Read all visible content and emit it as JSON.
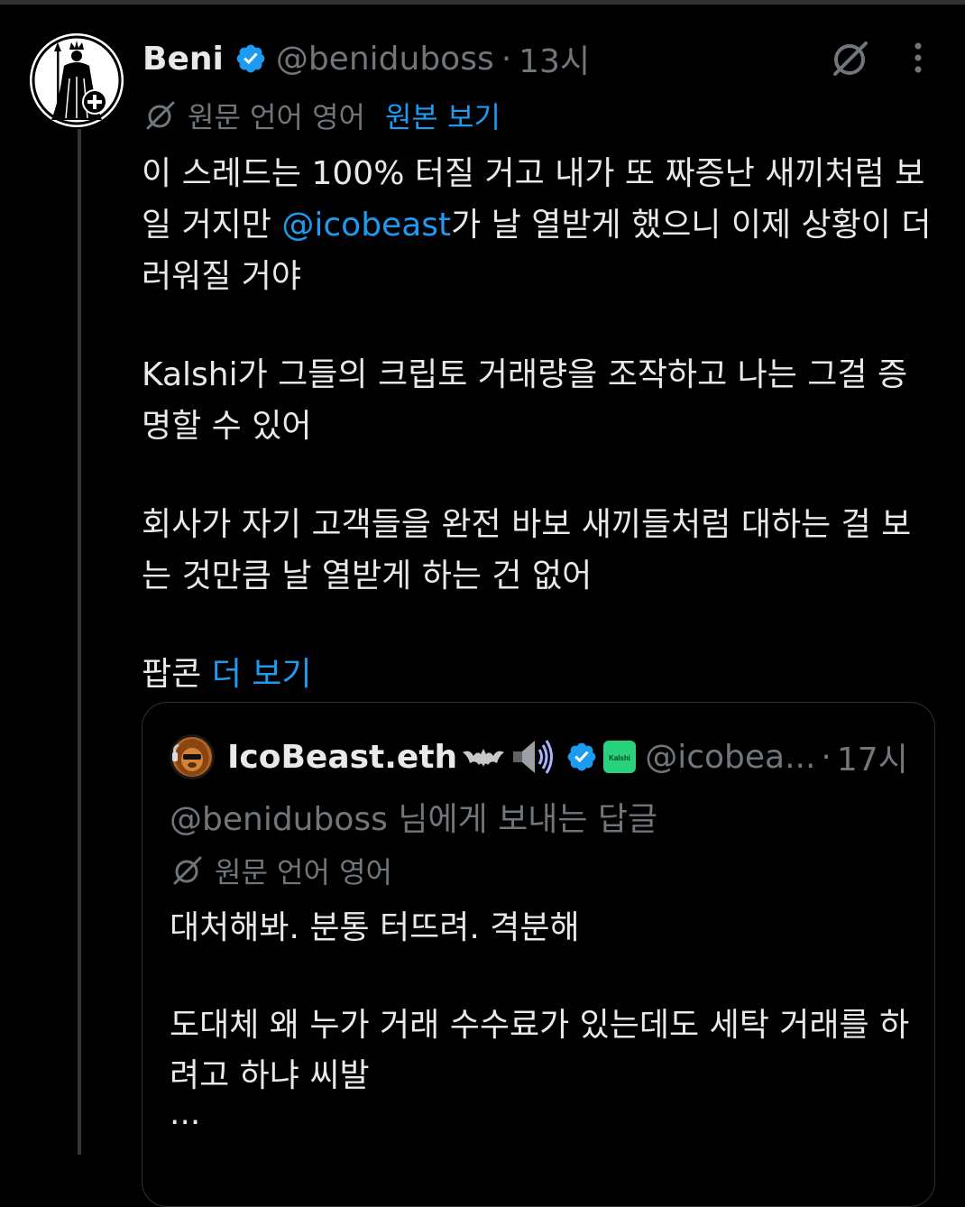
{
  "tweet": {
    "author_name": "Beni",
    "author_handle": "@beniduboss",
    "separator": "·",
    "time": "13시",
    "translation_label": "원문 언어 영어",
    "show_original_label": "원본 보기",
    "paragraph1_a": "이 스레드는 100% 터질 거고 내가 또 짜증난 새끼처럼 보일 거지만 ",
    "paragraph1_mention": "@icobeast",
    "paragraph1_b": "가 날 열받게 했으니 이제 상황이 더러워질 거야",
    "paragraph2": "Kalshi가 그들의 크립토 거래량을 조작하고 나는 그걸 증명할 수 있어",
    "paragraph3": "회사가 자기 고객들을 완전 바보 새끼들처럼 대하는 걸 보는 것만큼 날 열받게 하는 건 없어",
    "paragraph4_prefix": "팝콘 ",
    "show_more_label": "더 보기"
  },
  "quote": {
    "author_name": "IcoBeast.eth",
    "affiliate_badge_text": "Kalshi",
    "author_handle": "@icobea...",
    "separator": "·",
    "time": "17시",
    "reply_context": "@beniduboss 님에게 보내는 답글",
    "translation_label": "원문 언어 영어",
    "line1": "대처해봐. 분통 터뜨려. 격분해",
    "line2": "도대체 왜 누가 거래 수수료가 있는데도 세탁 거래를 하려고 하냐 씨발",
    "ellipsis": "..."
  },
  "colors": {
    "background": "#000000",
    "text_primary": "#e7e9ea",
    "text_secondary": "#71767b",
    "accent_link": "#1d9bf0",
    "border": "#2f3336",
    "kalshi_green": "#28d17c"
  },
  "icons": [
    "avatar-statue",
    "verified-badge",
    "grok-icon",
    "more-options-icon",
    "translate-icon",
    "speaker-emoji",
    "bat-emoji"
  ]
}
